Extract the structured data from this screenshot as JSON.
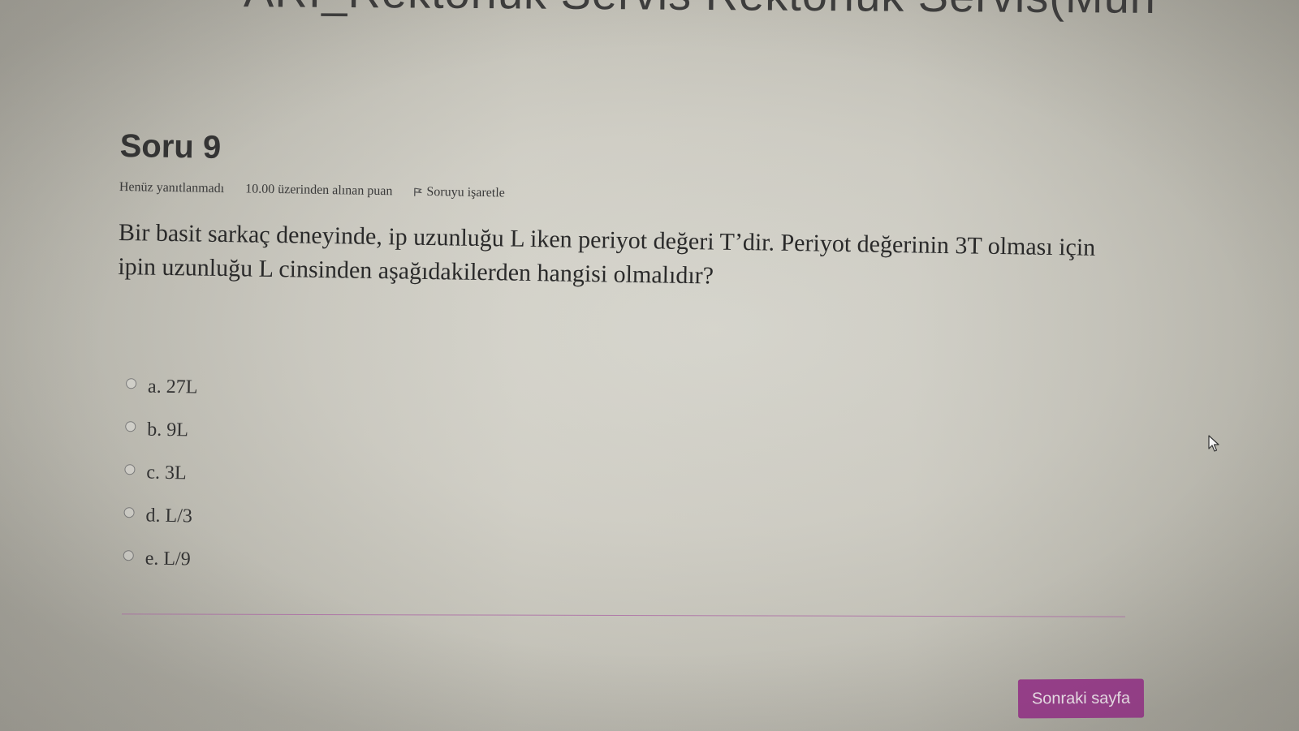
{
  "header": {
    "title": "ARI_Rektörlük Servis Rektörlük Servis(Mün"
  },
  "question": {
    "title": "Soru 9",
    "status": "Henüz yanıtlanmadı",
    "grade": "10.00 üzerinden alınan puan",
    "flag_label": "Soruyu işaretle",
    "text": "Bir basit sarkaç deneyinde, ip uzunluğu L iken periyot değeri T’dir. Periyot değerinin 3T olması için ipin uzunluğu L cinsinden aşağıdakilerden hangisi olmalıdır?"
  },
  "answers": [
    {
      "label": "a. 27L"
    },
    {
      "label": "b. 9L"
    },
    {
      "label": "c. 3L"
    },
    {
      "label": "d. L/3"
    },
    {
      "label": "e. L/9"
    }
  ],
  "navigation": {
    "next_label": "Sonraki sayfa"
  },
  "colors": {
    "accent": "#9a3f8d",
    "divider": "#b07aa8"
  },
  "icons": {
    "flag": "flag-icon",
    "pointer": "mouse-pointer-icon"
  }
}
